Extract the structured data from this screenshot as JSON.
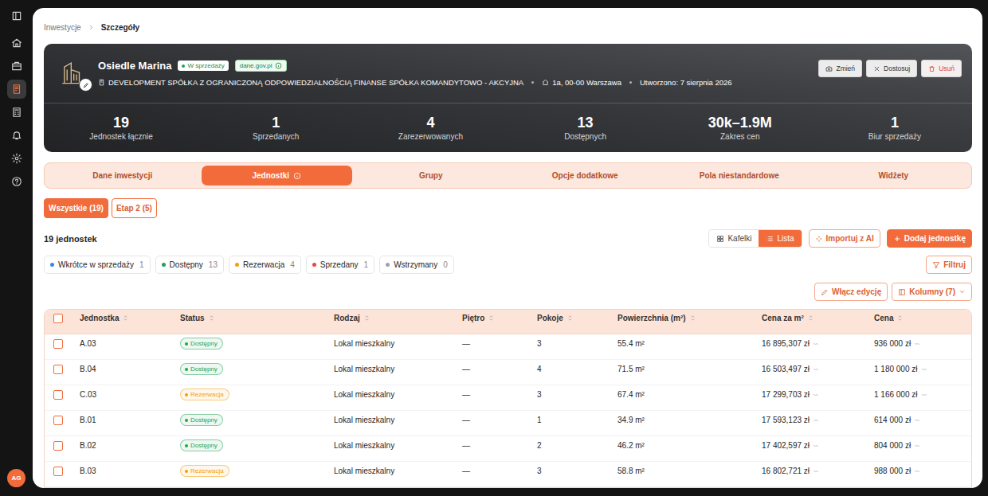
{
  "rail": {
    "items": [
      {
        "selected": false
      },
      {
        "selected": false
      },
      {
        "selected": false
      },
      {
        "selected": true
      },
      {
        "selected": false
      },
      {
        "selected": false
      },
      {
        "selected": false
      },
      {
        "selected": false
      }
    ],
    "avatar": "AG"
  },
  "breadcrumb": [
    "Inwestycje",
    "Szczegóły"
  ],
  "hero": {
    "title": "Osiedle Marina",
    "status": "W sprzedaży",
    "source": "dane.gov.pl",
    "company": "DEVELOPMENT SPÓŁKA Z OGRANICZONĄ ODPOWIEDZIALNOŚCIĄ FINANSE SPÓŁKA KOMANDYTOWO - AKCYJNA",
    "address": "1a, 00-00 Warszawa",
    "created": "Utworzono: 7 sierpnia 2026",
    "actions": [
      {
        "label": "Zmień",
        "kind": "default"
      },
      {
        "label": "Dostosuj",
        "kind": "default"
      },
      {
        "label": "Usuń",
        "kind": "danger"
      }
    ],
    "stats": [
      {
        "value": "19",
        "label": "Jednostek łącznie"
      },
      {
        "value": "1",
        "label": "Sprzedanych"
      },
      {
        "value": "4",
        "label": "Zarezerwowanych"
      },
      {
        "value": "13",
        "label": "Dostępnych"
      },
      {
        "value": "30k–1.9M",
        "label": "Zakres cen"
      },
      {
        "value": "1",
        "label": "Biur sprzedaży"
      }
    ]
  },
  "tabs": [
    {
      "label": "Dane inwestycji",
      "selected": false,
      "info": false
    },
    {
      "label": "Jednostki",
      "selected": true,
      "info": true
    },
    {
      "label": "Grupy",
      "selected": false,
      "info": false
    },
    {
      "label": "Opcje dodatkowe",
      "selected": false,
      "info": false
    },
    {
      "label": "Pola niestandardowe",
      "selected": false,
      "info": false
    },
    {
      "label": "Widżety",
      "selected": false,
      "info": false
    }
  ],
  "phases": [
    {
      "label": "Wszystkie (19)",
      "selected": true
    },
    {
      "label": "Etap 2 (5)",
      "selected": false
    }
  ],
  "toolbar": {
    "count": "19 jednostek",
    "views": [
      {
        "label": "Kafelki",
        "selected": false
      },
      {
        "label": "Lista",
        "selected": true
      }
    ],
    "import": "Importuj z AI",
    "add": "Dodaj jednostkę",
    "filter": "Filtruj",
    "edit": "Włącz edycję",
    "columns": "Kolumny (7)"
  },
  "legend": [
    {
      "label": "Wkrótce w sprzedaży",
      "count": "1",
      "color": "#3b82f6"
    },
    {
      "label": "Dostępny",
      "count": "13",
      "color": "#22a355"
    },
    {
      "label": "Rezerwacja",
      "count": "4",
      "color": "#f59e0b"
    },
    {
      "label": "Sprzedany",
      "count": "1",
      "color": "#ef4444"
    },
    {
      "label": "Wstrzymany",
      "count": "0",
      "color": "#9ca3af"
    }
  ],
  "table": {
    "all_checked": false,
    "columns": [
      "Jednostka",
      "Status",
      "Rodzaj",
      "Piętro",
      "Pokoje",
      "Powierzchnia (m²)",
      "Cena za m²",
      "Cena"
    ],
    "rows": [
      {
        "unit": "A.03",
        "status": "Dostępny",
        "color": "#22a355",
        "type": "Lokal mieszkalny",
        "floor": "—",
        "rooms": "3",
        "area": "55.4 m²",
        "price_m2": "16 895,307 zł",
        "price": "936 000 zł",
        "checked": false
      },
      {
        "unit": "B.04",
        "status": "Dostępny",
        "color": "#22a355",
        "type": "Lokal mieszkalny",
        "floor": "—",
        "rooms": "4",
        "area": "71.5 m²",
        "price_m2": "16 503,497 zł",
        "price": "1 180 000 zł",
        "checked": false
      },
      {
        "unit": "C.03",
        "status": "Rezerwacja",
        "color": "#f59e0b",
        "type": "Lokal mieszkalny",
        "floor": "—",
        "rooms": "3",
        "area": "67.4 m²",
        "price_m2": "17 299,703 zł",
        "price": "1 166 000 zł",
        "checked": false
      },
      {
        "unit": "B.01",
        "status": "Dostępny",
        "color": "#22a355",
        "type": "Lokal mieszkalny",
        "floor": "—",
        "rooms": "1",
        "area": "34.9 m²",
        "price_m2": "17 593,123 zł",
        "price": "614 000 zł",
        "checked": false
      },
      {
        "unit": "B.02",
        "status": "Dostępny",
        "color": "#22a355",
        "type": "Lokal mieszkalny",
        "floor": "—",
        "rooms": "2",
        "area": "46.2 m²",
        "price_m2": "17 402,597 zł",
        "price": "804 000 zł",
        "checked": false
      },
      {
        "unit": "B.03",
        "status": "Rezerwacja",
        "color": "#f59e0b",
        "type": "Lokal mieszkalny",
        "floor": "—",
        "rooms": "3",
        "area": "58.8 m²",
        "price_m2": "16 802,721 zł",
        "price": "988 000 zł",
        "checked": false
      }
    ]
  }
}
